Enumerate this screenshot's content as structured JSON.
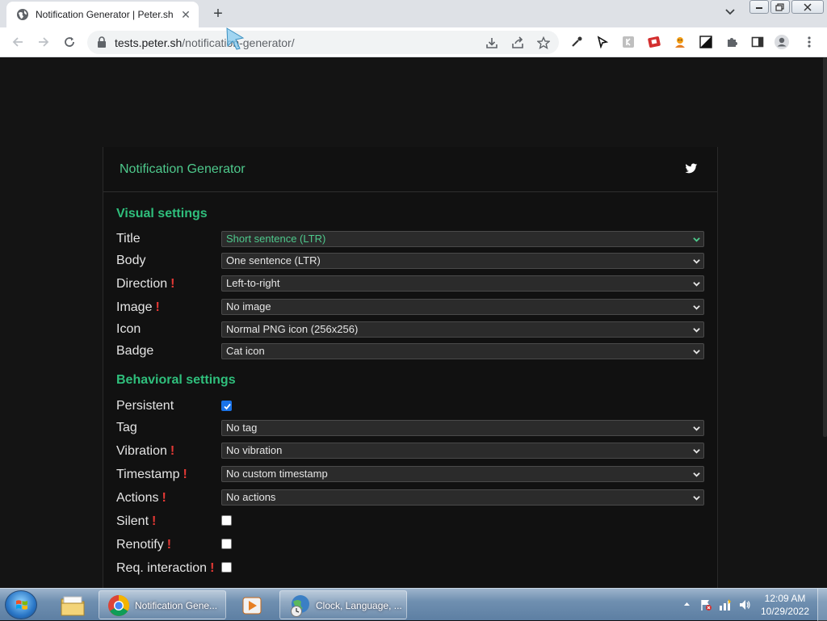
{
  "browser": {
    "tab_title": "Notification Generator | Peter.sh",
    "tab_close": "✕",
    "new_tab": "+",
    "url_host": "tests.peter.sh",
    "url_path": "/notification-generator/"
  },
  "page": {
    "card_title": "Notification Generator",
    "visual_section": "Visual settings",
    "behavioral_section": "Behavioral settings",
    "bang": "!",
    "visual_rows": [
      {
        "label": "Title",
        "value": "Short sentence (LTR)",
        "warning": false
      },
      {
        "label": "Body",
        "value": "One sentence (LTR)",
        "warning": false
      },
      {
        "label": "Direction",
        "value": "Left-to-right",
        "warning": true
      },
      {
        "label": "Image",
        "value": "No image",
        "warning": true
      },
      {
        "label": "Icon",
        "value": "Normal PNG icon (256x256)",
        "warning": false
      },
      {
        "label": "Badge",
        "value": "Cat icon",
        "warning": false
      }
    ],
    "behavioral_rows": [
      {
        "label": "Persistent",
        "type": "checkbox",
        "checked": true,
        "warning": false
      },
      {
        "label": "Tag",
        "type": "select",
        "value": "No tag",
        "warning": false
      },
      {
        "label": "Vibration",
        "type": "select",
        "value": "No vibration",
        "warning": true
      },
      {
        "label": "Timestamp",
        "type": "select",
        "value": "No custom timestamp",
        "warning": true
      },
      {
        "label": "Actions",
        "type": "select",
        "value": "No actions",
        "warning": true
      },
      {
        "label": "Silent",
        "type": "checkbox",
        "checked": false,
        "warning": true
      },
      {
        "label": "Renotify",
        "type": "checkbox",
        "checked": false,
        "warning": true
      },
      {
        "label": "Req. interaction",
        "type": "checkbox",
        "checked": false,
        "warning": true
      }
    ]
  },
  "taskbar": {
    "chrome_label": "Notification Gene...",
    "clock_app_label": "Clock, Language, ...",
    "time": "12:09 AM",
    "date": "10/29/2022"
  },
  "colors": {
    "accent": "#2fbf7c",
    "warning": "#e53935",
    "page_bg": "#141414"
  },
  "icons": [
    "globe-icon",
    "lock-icon",
    "twitter-icon",
    "chevron-down-icon",
    "windows-start-icon",
    "chrome-icon",
    "folder-icon",
    "media-player-icon",
    "control-panel-icon"
  ]
}
